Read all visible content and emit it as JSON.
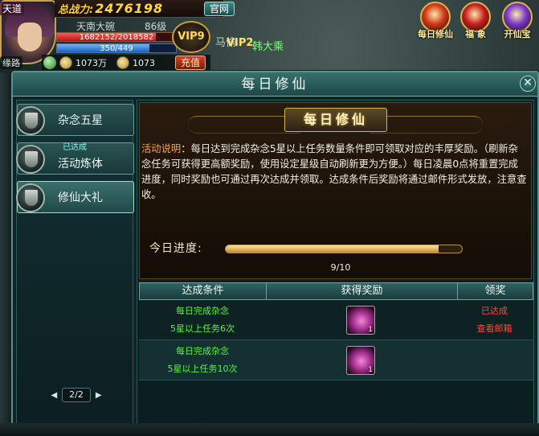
{
  "hud": {
    "server_label": "天道",
    "avatar_name": "缘路",
    "power_label": "总战力:",
    "power_value": "2476198",
    "official_site": "官网",
    "char_name": "天南大碗",
    "char_level": "86级",
    "hp_text": "1682152/2018582",
    "hp_fraction": 0.833,
    "mp_text": "350/449",
    "mp_fraction": 0.78,
    "vip_badge": "VIP9",
    "currency_1": "1073万",
    "currency_2": "1073",
    "recharge": "充值"
  },
  "target": {
    "partial_text": "马偷",
    "vip": "VIP2",
    "name": "韩大乘"
  },
  "func_icons": [
    {
      "label": "每日修仙",
      "icon": "fire-orb-icon",
      "color": "#d13a1a"
    },
    {
      "label": "福 象",
      "icon": "fortune-orb-icon",
      "color": "#c62020"
    },
    {
      "label": "开仙宝",
      "icon": "treasure-orb-icon",
      "color": "#7a3ac8"
    }
  ],
  "dialog": {
    "title": "每日修仙",
    "close": "✕"
  },
  "tabs": [
    {
      "label": "杂念五星",
      "sub": ""
    },
    {
      "label": "活动炼体",
      "sub": "已达成"
    },
    {
      "label": "修仙大礼",
      "sub": ""
    }
  ],
  "pager": {
    "prev": "◀",
    "text": "2/2",
    "next": "▶"
  },
  "banner": {
    "title": "每日修仙"
  },
  "description": {
    "label": "活动说明",
    "text": "：每日达到完成杂念5星以上任务数量条件即可领取对应的丰厚奖励。（刷新杂念任务可获得更高额奖励，使用设定星级自动刷新更为方便。）每日凌晨0点将重置完成进度，同时奖励也可通过再次达成并领取。达成条件后奖励将通过邮件形式发放，注意查收。"
  },
  "progress": {
    "label": "今日进度:",
    "current": 9,
    "total": 10,
    "text": "9/10"
  },
  "table": {
    "headers": [
      "达成条件",
      "获得奖励",
      "领奖"
    ],
    "rows": [
      {
        "cond_line1": "每日完成杂念",
        "cond_line2": "5星以上任务6次",
        "reward_icon": "pink-orb-icon",
        "reward_count": "1",
        "status_line1": "已达成",
        "status_line2": "查看邮箱"
      },
      {
        "cond_line1": "每日完成杂念",
        "cond_line2": "5星以上任务10次",
        "reward_icon": "pink-orb-icon",
        "reward_count": "1",
        "status_line1": "",
        "status_line2": ""
      }
    ]
  }
}
